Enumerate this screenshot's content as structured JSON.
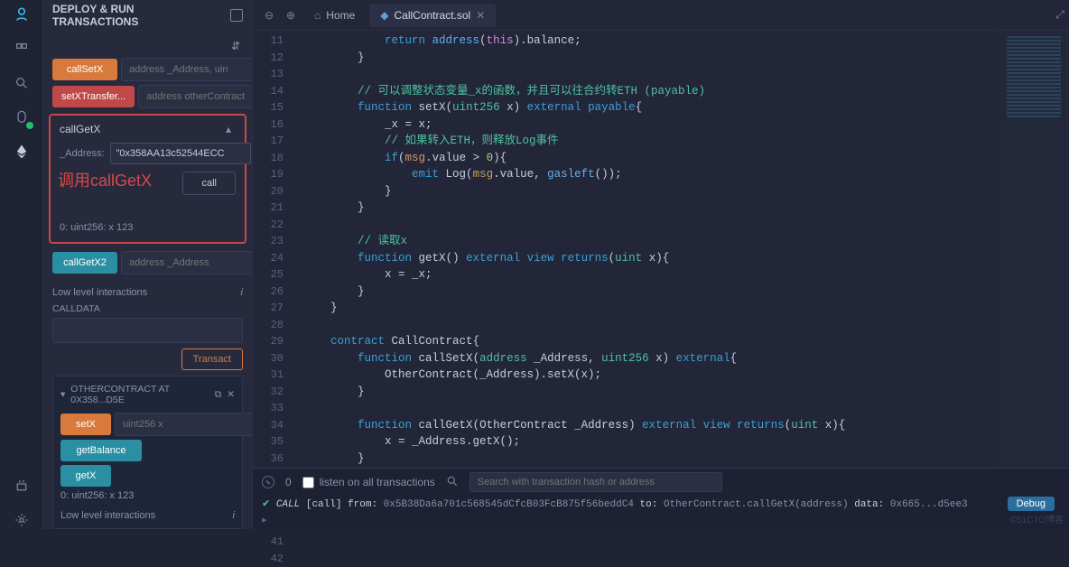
{
  "sidebar": {
    "title": "DEPLOY & RUN TRANSACTIONS",
    "functions": {
      "callSetX": {
        "label": "callSetX",
        "placeholder": "address _Address, uin"
      },
      "setXTransfer": {
        "label": "setXTransfer...",
        "placeholder": "address otherContract"
      },
      "callGetX": {
        "label": "callGetX",
        "field_label": "_Address:",
        "field_value": "\"0x358AA13c52544ECC",
        "call_label": "call",
        "overlay": "调用callGetX",
        "result": "0: uint256: x 123"
      },
      "callGetX2": {
        "label": "callGetX2",
        "placeholder": "address _Address"
      }
    },
    "low_level": {
      "title": "Low level interactions",
      "calldata_label": "CALLDATA",
      "transact": "Transact"
    },
    "instance2": {
      "title": "OTHERCONTRACT AT 0X358...D5E",
      "setX": {
        "label": "setX",
        "placeholder": "uint256 x"
      },
      "getBalance": {
        "label": "getBalance"
      },
      "getX": {
        "label": "getX"
      },
      "result": "0: uint256: x 123"
    },
    "low_level2": {
      "title": "Low level interactions"
    }
  },
  "tabs": {
    "home": "Home",
    "file": "CallContract.sol"
  },
  "editor": {
    "first_line": 11,
    "last_line": 42
  },
  "terminal": {
    "listen_label": "listen on all transactions",
    "search_placeholder": "Search with transaction hash or address",
    "line_prefix": "CALL",
    "line_call_label": "[call]",
    "line_from_label": "from:",
    "line_from": "0x5B38Da6a701c568545dCfcB03FcB875f56beddC4",
    "line_to_label": "to:",
    "line_to": "OtherContract.callGetX(address)",
    "line_data_label": "data:",
    "line_data": "0x665...d5ee3",
    "debug": "Debug"
  },
  "watermark": "©51CTO博客"
}
